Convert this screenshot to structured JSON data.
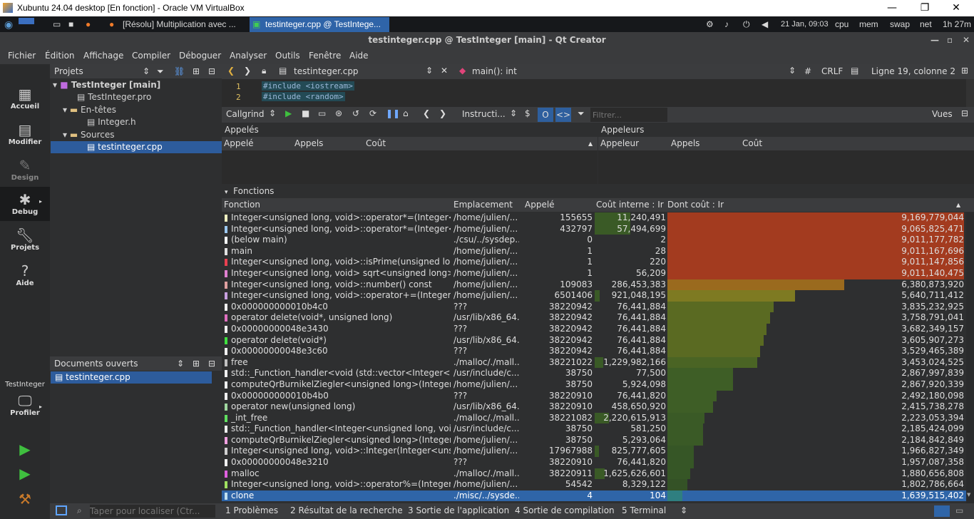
{
  "vbox": {
    "title": "Xubuntu 24.04 desktop [En fonction] - Oracle VM VirtualBox",
    "min": "—",
    "max": "❐",
    "close": "✕"
  },
  "panel": {
    "task1": "[Résolu] Multiplication avec ...",
    "task2": "testinteger.cpp @ TestIntege...",
    "clock": "21 Jan, 09:03",
    "cpu": "cpu",
    "mem": "mem",
    "swap": "swap",
    "net": "net",
    "uptime": "1h 27m"
  },
  "window_title": "testinteger.cpp @ TestInteger [main] - Qt Creator",
  "menu": [
    "Fichier",
    "Édition",
    "Affichage",
    "Compiler",
    "Déboguer",
    "Analyser",
    "Outils",
    "Fenêtre",
    "Aide"
  ],
  "modes": {
    "accueil": "Accueil",
    "modifier": "Modifier",
    "design": "Design",
    "debug": "Debug",
    "projets": "Projets",
    "aide": "Aide",
    "kit": "TestInteger",
    "profiler": "Profiler"
  },
  "projects": {
    "header": "Projets",
    "root": "TestInteger [main]",
    "pro": "TestInteger.pro",
    "headers": "En-têtes",
    "integer_h": "Integer.h",
    "sources": "Sources",
    "cpp": "testinteger.cpp"
  },
  "open_docs": {
    "header": "Documents ouverts",
    "file": "testinteger.cpp"
  },
  "editor": {
    "file": "testinteger.cpp",
    "symbol": "main(): int",
    "hash": "#",
    "eol": "CRLF",
    "position": "Ligne 19, colonne 2"
  },
  "code": [
    {
      "n": "1",
      "text": "#include <iostream>"
    },
    {
      "n": "2",
      "text": "#include <random>"
    }
  ],
  "callgrind": {
    "tool": "Callgrind",
    "event": "Instructi...",
    "filter_placeholder": "Filtrer...",
    "views": "Vues"
  },
  "callees": {
    "title": "Appelés",
    "cols": [
      "Appelé",
      "Appels",
      "Coût"
    ]
  },
  "callers": {
    "title": "Appeleurs",
    "cols": [
      "Appeleur",
      "Appels",
      "Coût"
    ]
  },
  "functions": {
    "title": "Fonctions",
    "cols": [
      "Fonction",
      "Emplacement",
      "Appelé",
      "Coût interne : Ir",
      "Dont coût : Ir"
    ],
    "rows": [
      {
        "fn": "Integer<unsigned long, void>::operator*=(Integer<u...",
        "loc": "/home/julien/...",
        "calls": "155655",
        "self": "11,240,491",
        "incl": "9,169,779,044",
        "sw": "#f0f0c0",
        "selfpct": 0.5,
        "inclpct": 1.0,
        "color": "#a33b1f"
      },
      {
        "fn": "Integer<unsigned long, void>::operator*=(Integer<u...",
        "loc": "/home/julien/...",
        "calls": "432797",
        "self": "57,494,699",
        "incl": "9,065,825,471",
        "sw": "#9cc8f0",
        "selfpct": 0.5,
        "inclpct": 1.0,
        "color": "#a33b1f"
      },
      {
        "fn": "(below main)",
        "loc": "./csu/../sysdep...",
        "calls": "0",
        "self": "2",
        "incl": "9,011,177,782",
        "sw": "#ffffff",
        "selfpct": 0,
        "inclpct": 1.0,
        "color": "#a33b1f"
      },
      {
        "fn": "main",
        "loc": "/home/julien/...",
        "calls": "1",
        "self": "28",
        "incl": "9,011,167,696",
        "sw": "#e0e0e0",
        "selfpct": 0,
        "inclpct": 1.0,
        "color": "#a33b1f"
      },
      {
        "fn": "Integer<unsigned long, void>::isPrime(unsigned long...",
        "loc": "/home/julien/...",
        "calls": "1",
        "self": "220",
        "incl": "9,011,147,856",
        "sw": "#e84050",
        "selfpct": 0,
        "inclpct": 1.0,
        "color": "#a33b1f"
      },
      {
        "fn": "Integer<unsigned long, void> sqrt<unsigned long>(I...",
        "loc": "/home/julien/...",
        "calls": "1",
        "self": "56,209",
        "incl": "9,011,140,475",
        "sw": "#e080d0",
        "selfpct": 0,
        "inclpct": 1.0,
        "color": "#a33b1f"
      },
      {
        "fn": "Integer<unsigned long, void>::number() const",
        "loc": "/home/julien/...",
        "calls": "109083",
        "self": "286,453,383",
        "incl": "6,380,873,920",
        "sw": "#e0a0a0",
        "selfpct": 0,
        "inclpct": 0.597,
        "color": "#9a6a1e"
      },
      {
        "fn": "Integer<unsigned long, void>::operator+=(Integer<u...",
        "loc": "/home/julien/...",
        "calls": "6501406",
        "self": "921,048,195",
        "incl": "5,640,711,412",
        "sw": "#c8a0e0",
        "selfpct": 0.07,
        "inclpct": 0.43,
        "color": "#7e7a22"
      },
      {
        "fn": "0x000000000010b4c0",
        "loc": "???",
        "calls": "38220942",
        "self": "76,441,884",
        "incl": "3,835,232,925",
        "sw": "#f0f0f0",
        "selfpct": 0,
        "inclpct": 0.357,
        "color": "#5a6a22"
      },
      {
        "fn": "operator delete(void*, unsigned long)",
        "loc": "/usr/lib/x86_64...",
        "calls": "38220942",
        "self": "76,441,884",
        "incl": "3,758,791,041",
        "sw": "#e070c0",
        "selfpct": 0,
        "inclpct": 0.346,
        "color": "#5a6a22"
      },
      {
        "fn": "0x00000000048e3430",
        "loc": "???",
        "calls": "38220942",
        "self": "76,441,884",
        "incl": "3,682,349,157",
        "sw": "#f0f0f0",
        "selfpct": 0,
        "inclpct": 0.335,
        "color": "#5a6a22"
      },
      {
        "fn": "operator delete(void*)",
        "loc": "/usr/lib/x86_64...",
        "calls": "38220942",
        "self": "76,441,884",
        "incl": "3,605,907,273",
        "sw": "#40e040",
        "selfpct": 0,
        "inclpct": 0.324,
        "color": "#5a6a22"
      },
      {
        "fn": "0x00000000048e3c60",
        "loc": "???",
        "calls": "38220942",
        "self": "76,441,884",
        "incl": "3,529,465,389",
        "sw": "#f0f0f0",
        "selfpct": 0,
        "inclpct": 0.313,
        "color": "#5a6a22"
      },
      {
        "fn": "free",
        "loc": "./malloc/./mall...",
        "calls": "38221022",
        "self": "1,229,982,166",
        "incl": "3,453,024,525",
        "sw": "#c0c0c0",
        "selfpct": 0.12,
        "inclpct": 0.302,
        "color": "#4a6424"
      },
      {
        "fn": "std::_Function_handler<void (std::vector<Integer<uns...",
        "loc": "/usr/include/c...",
        "calls": "38750",
        "self": "77,500",
        "incl": "2,867,997,839",
        "sw": "#f0f0f0",
        "selfpct": 0,
        "inclpct": 0.22,
        "color": "#3e5e26"
      },
      {
        "fn": "computeQrBurnikelZiegler<unsigned long>(Integer<...",
        "loc": "/home/julien/...",
        "calls": "38750",
        "self": "5,924,098",
        "incl": "2,867,920,339",
        "sw": "#f0f0f0",
        "selfpct": 0,
        "inclpct": 0.22,
        "color": "#3e5e26"
      },
      {
        "fn": "0x000000000010b4b0",
        "loc": "???",
        "calls": "38220910",
        "self": "76,441,820",
        "incl": "2,492,180,098",
        "sw": "#f0f0f0",
        "selfpct": 0,
        "inclpct": 0.165,
        "color": "#3e5e26"
      },
      {
        "fn": "operator new(unsigned long)",
        "loc": "/usr/lib/x86_64...",
        "calls": "38220910",
        "self": "458,650,920",
        "incl": "2,415,738,278",
        "sw": "#a0d8a0",
        "selfpct": 0,
        "inclpct": 0.154,
        "color": "#3e5e26"
      },
      {
        "fn": "_int_free",
        "loc": "./malloc/./mall...",
        "calls": "38221082",
        "self": "2,220,615,913",
        "incl": "2,223,053,394",
        "sw": "#60e060",
        "selfpct": 0.2,
        "inclpct": 0.126,
        "color": "#3a5a26"
      },
      {
        "fn": "std::_Function_handler<Integer<unsigned long, void>...",
        "loc": "/usr/include/c...",
        "calls": "38750",
        "self": "581,250",
        "incl": "2,185,424,099",
        "sw": "#f0f0f0",
        "selfpct": 0,
        "inclpct": 0.12,
        "color": "#3a5a26"
      },
      {
        "fn": "computeQrBurnikelZiegler<unsigned long>(Integer<...",
        "loc": "/home/julien/...",
        "calls": "38750",
        "self": "5,293,064",
        "incl": "2,184,842,849",
        "sw": "#f0a0e0",
        "selfpct": 0,
        "inclpct": 0.12,
        "color": "#3a5a26"
      },
      {
        "fn": "Integer<unsigned long, void>::Integer(Integer<unsig...",
        "loc": "/home/julien/...",
        "calls": "17967988",
        "self": "825,777,605",
        "incl": "1,966,827,349",
        "sw": "#d0d0d0",
        "selfpct": 0.06,
        "inclpct": 0.09,
        "color": "#365626"
      },
      {
        "fn": "0x00000000048e3210",
        "loc": "???",
        "calls": "38220910",
        "self": "76,441,820",
        "incl": "1,957,087,358",
        "sw": "#f0f0f0",
        "selfpct": 0,
        "inclpct": 0.088,
        "color": "#365626"
      },
      {
        "fn": "malloc",
        "loc": "./malloc/./mall...",
        "calls": "38220911",
        "self": "1,625,626,601",
        "incl": "1,880,656,808",
        "sw": "#e060e0",
        "selfpct": 0.14,
        "inclpct": 0.078,
        "color": "#365626"
      },
      {
        "fn": "Integer<unsigned long, void>::operator%=(Integer<u...",
        "loc": "/home/julien/...",
        "calls": "54542",
        "self": "8,329,122",
        "incl": "1,802,786,664",
        "sw": "#a0e060",
        "selfpct": 0,
        "inclpct": 0.068,
        "color": "#345226"
      },
      {
        "fn": "clone",
        "loc": "./misc/../sysde...",
        "calls": "4",
        "self": "104",
        "incl": "1,639,515,402",
        "sw": "#c0e0f0",
        "selfpct": 0,
        "inclpct": 0.05,
        "color": "#2f5f92",
        "selected": true
      }
    ]
  },
  "status": {
    "search_placeholder": "Taper pour localiser (Ctr...",
    "tabs": [
      "1  Problèmes",
      "2  Résultat de la recherche",
      "3  Sortie de l'application",
      "4  Sortie de compilation",
      "5  Terminal"
    ]
  }
}
